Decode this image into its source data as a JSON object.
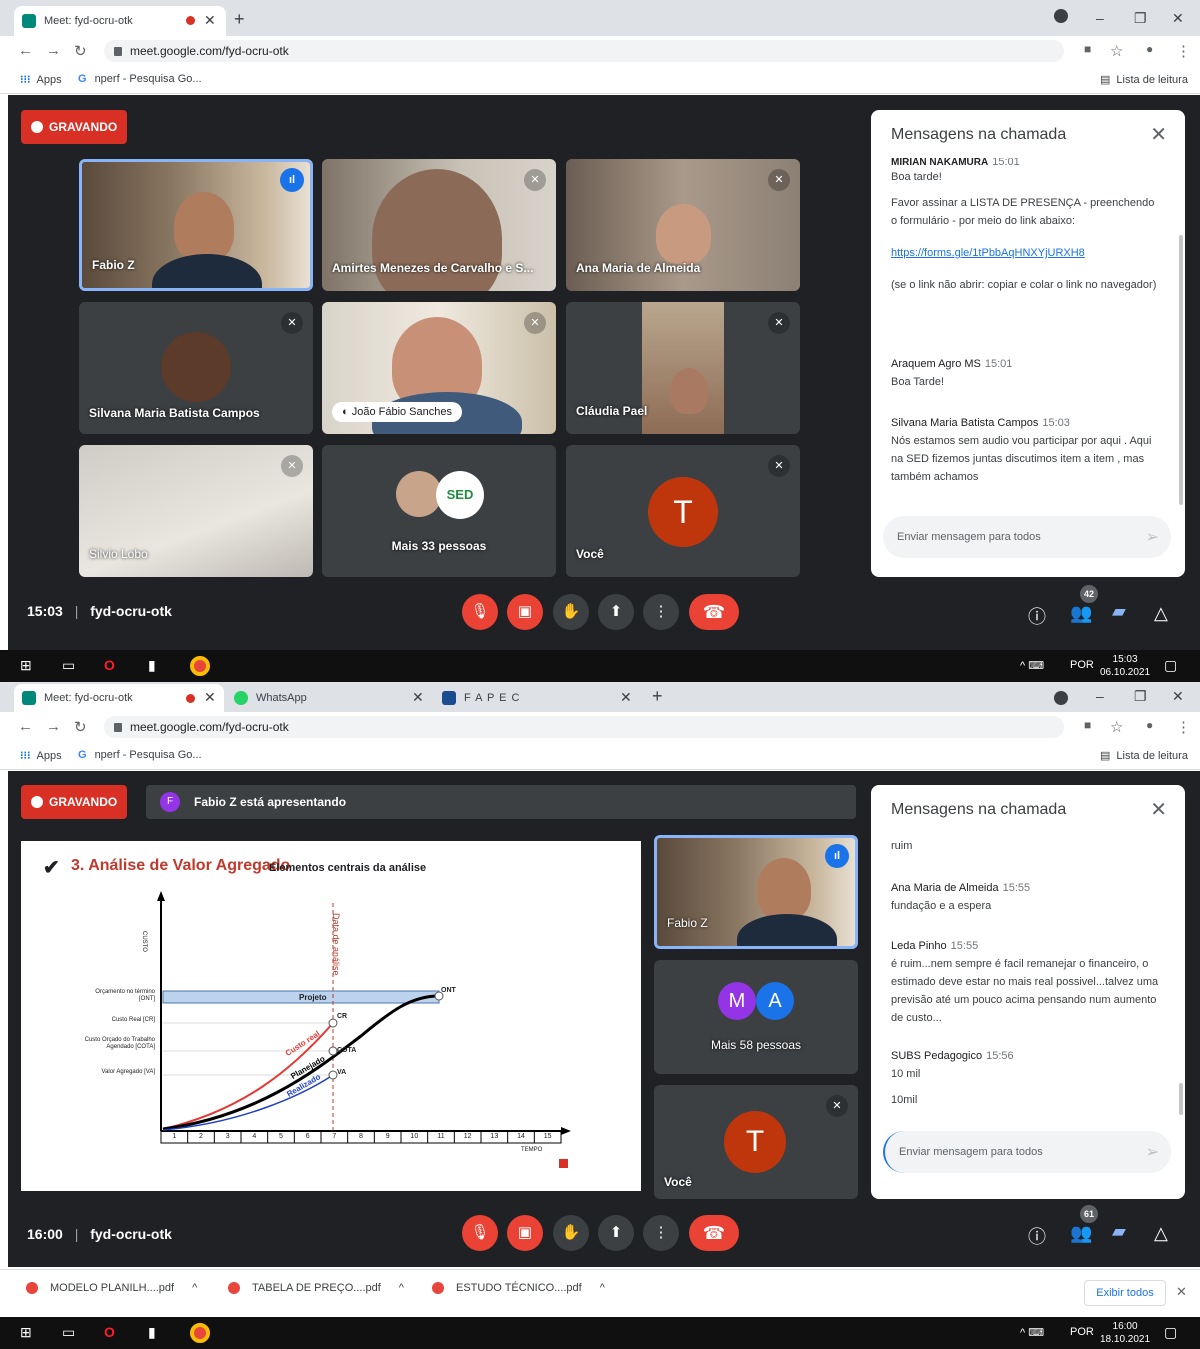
{
  "screen1": {
    "tabs": [
      {
        "label": "Meet: fyd-ocru-otk"
      }
    ],
    "url": "meet.google.com/fyd-ocru-otk",
    "bookmarks": {
      "apps": "Apps",
      "item1": "nperf - Pesquisa Go...",
      "reading_list": "Lista de leitura"
    },
    "recording_label": "GRAVANDO",
    "tiles": [
      {
        "name": "Fabio Z"
      },
      {
        "name": "Amirtes Menezes de Carvalho e S..."
      },
      {
        "name": "Ana Maria de Almeida"
      },
      {
        "name": "Silvana Maria Batista Campos"
      },
      {
        "name": "João Fábio Sanches"
      },
      {
        "name": "Cláudia Pael"
      },
      {
        "name": "Silvio Lobo"
      },
      {
        "name": "Mais 33 pessoas"
      },
      {
        "name": "Você",
        "initial": "T"
      }
    ],
    "chat": {
      "title": "Mensagens na chamada",
      "messages": [
        {
          "who": "MIRIAN NAKAMURA",
          "time": "15:01",
          "lines": [
            "Boa tarde!",
            "Favor assinar a LISTA DE PRESENÇA - preenchendo o formulário - por meio do link abaixo:"
          ],
          "link": "https://forms.gle/1tPbbAqHNXYjURXH8",
          "after": "(se o link não abrir: copiar e colar o link no navegador)"
        },
        {
          "who": "Araquem Agro MS",
          "time": "15:01",
          "text": "Boa Tarde!"
        },
        {
          "who": "Silvana Maria Batista Campos",
          "time": "15:03",
          "text": "Nós estamos sem audio vou participar por aqui . Aqui na SED fizemos juntas discutimos item a item , mas também achamos"
        }
      ],
      "input_placeholder": "Enviar mensagem para todos"
    },
    "meeting_time": "15:03",
    "meeting_code": "fyd-ocru-otk",
    "participants_count": "42",
    "taskbar": {
      "lang": "POR",
      "time": "15:03",
      "date": "06.10.2021"
    }
  },
  "screen2": {
    "tabs": [
      {
        "label": "Meet: fyd-ocru-otk"
      },
      {
        "label": "WhatsApp"
      },
      {
        "label": "F A P E C"
      }
    ],
    "url": "meet.google.com/fyd-ocru-otk",
    "bookmarks": {
      "apps": "Apps",
      "item1": "nperf - Pesquisa Go...",
      "reading_list": "Lista de leitura"
    },
    "recording_label": "GRAVANDO",
    "presenting_initial": "F",
    "presenting_label": "Fabio Z está apresentando",
    "slide": {
      "title": "3. Análise de Valor Agregado",
      "subtitle": "Elementos centrais da análise",
      "ylabel": "CUSTO",
      "xlabel": "TEMPO",
      "date_label": "Data de análise",
      "bar_label": "Projeto",
      "left_labels": [
        "Orçamento no término [ONT]",
        "Custo Real [CR]",
        "Custo Orçado do Trabalho Agendado [COTA]",
        "Valor Agregado [VA]"
      ],
      "point_labels": [
        "ONT",
        "CR",
        "COTA",
        "VA"
      ],
      "curve_labels": [
        "Custo real",
        "Planejado",
        "Realizado"
      ],
      "ticks": [
        "1",
        "2",
        "3",
        "4",
        "5",
        "6",
        "7",
        "8",
        "9",
        "10",
        "11",
        "12",
        "13",
        "14",
        "15"
      ]
    },
    "tiles": [
      {
        "name": "Fabio Z"
      },
      {
        "name": "Mais 58 pessoas",
        "avatars": [
          "M",
          "A"
        ]
      },
      {
        "name": "Você",
        "initial": "T"
      }
    ],
    "chat": {
      "title": "Mensagens na chamada",
      "messages": [
        {
          "text": "ruim"
        },
        {
          "who": "Ana Maria de Almeida",
          "time": "15:55",
          "text": "fundação e a espera"
        },
        {
          "who": "Leda Pinho",
          "time": "15:55",
          "text": "é ruim...nem sempre é facil remanejar o financeiro, o estimado deve estar no mais real possivel...talvez uma previsão até um pouco acima pensando num aumento de custo..."
        },
        {
          "who": "SUBS Pedagogico",
          "time": "15:56",
          "text": "10 mil"
        },
        {
          "text": "10mil"
        }
      ],
      "input_placeholder": "Enviar mensagem para todos"
    },
    "meeting_time": "16:00",
    "meeting_code": "fyd-ocru-otk",
    "participants_count": "61",
    "downloads": [
      "MODELO PLANILH....pdf",
      "TABELA DE PREÇO....pdf",
      "ESTUDO TÉCNICO....pdf"
    ],
    "show_all": "Exibir todos",
    "taskbar": {
      "lang": "POR",
      "time": "16:00",
      "date": "18.10.2021"
    }
  }
}
